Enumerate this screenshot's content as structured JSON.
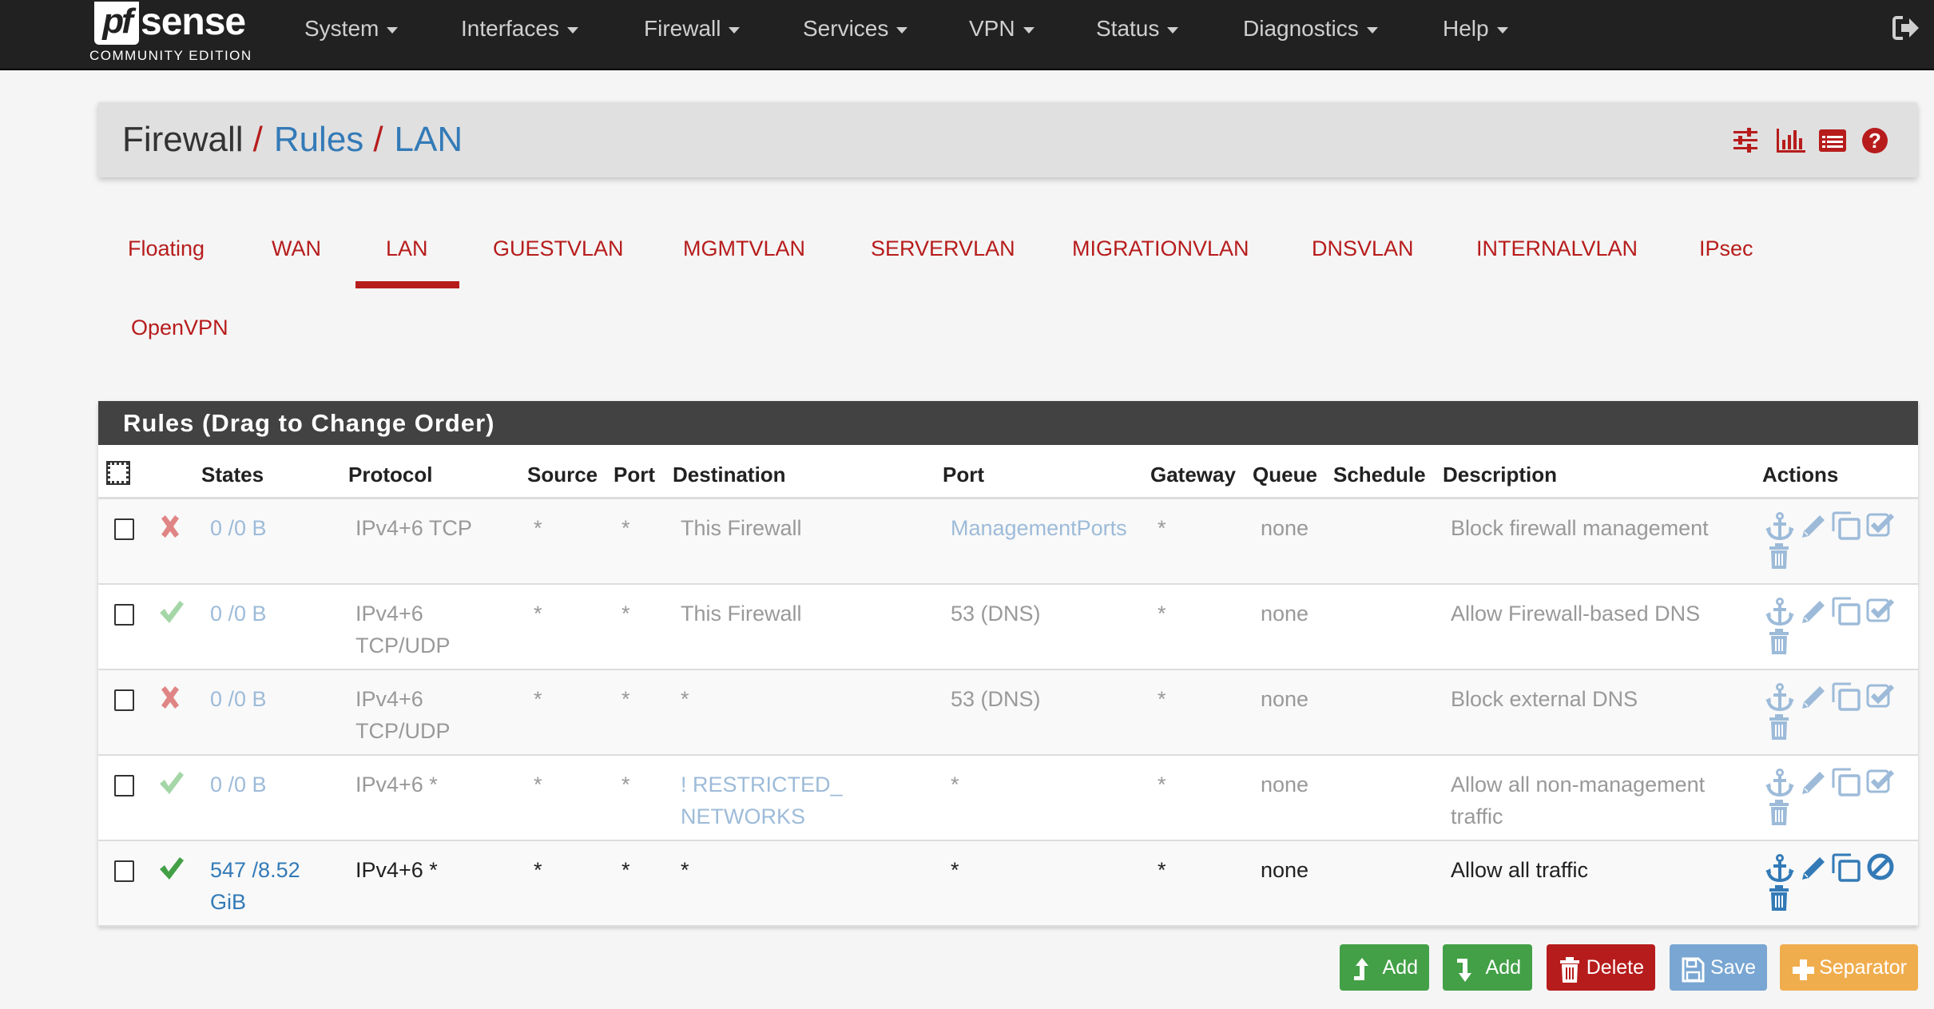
{
  "brand": {
    "logo_mark": "pf",
    "logo_word": "sense",
    "edition": "COMMUNITY EDITION"
  },
  "nav": {
    "items": [
      {
        "label": "System"
      },
      {
        "label": "Interfaces"
      },
      {
        "label": "Firewall"
      },
      {
        "label": "Services"
      },
      {
        "label": "VPN"
      },
      {
        "label": "Status"
      },
      {
        "label": "Diagnostics"
      },
      {
        "label": "Help"
      }
    ],
    "logout_icon": "sign-out-icon"
  },
  "breadcrumb": {
    "root": "Firewall",
    "separator": "/",
    "level1": "Rules",
    "level2": "LAN",
    "icons": [
      "sliders-icon",
      "bar-chart-icon",
      "list-table-icon",
      "help-circle-icon"
    ]
  },
  "tabs": {
    "items": [
      {
        "label": "Floating"
      },
      {
        "label": "WAN"
      },
      {
        "label": "LAN",
        "active": true
      },
      {
        "label": "GUESTVLAN"
      },
      {
        "label": "MGMTVLAN"
      },
      {
        "label": "SERVERVLAN"
      },
      {
        "label": "MIGRATIONVLAN"
      },
      {
        "label": "DNSVLAN"
      },
      {
        "label": "INTERNALVLAN"
      },
      {
        "label": "IPsec"
      },
      {
        "label": "OpenVPN"
      }
    ]
  },
  "rules": {
    "panel_title": "Rules (Drag to Change Order)",
    "columns": [
      "States",
      "Protocol",
      "Source",
      "Port",
      "Destination",
      "Port",
      "Gateway",
      "Queue",
      "Schedule",
      "Description",
      "Actions"
    ],
    "rows": [
      {
        "action": "block",
        "enabled": false,
        "states_line1": "0 /0 B",
        "states_line2": "",
        "protocol_line1": "IPv4+6 TCP",
        "protocol_line2": "",
        "source": "*",
        "source_port": "*",
        "destination_line1": "This Firewall",
        "destination_line2": "",
        "destination_is_alias": false,
        "dest_port": "ManagementPorts",
        "dest_port_is_alias": true,
        "gateway": "*",
        "queue": "none",
        "schedule": "",
        "description_line1": "Block firewall management",
        "description_line2": "",
        "toggle_icon": "check-square-icon"
      },
      {
        "action": "pass",
        "enabled": false,
        "states_line1": "0 /0 B",
        "states_line2": "",
        "protocol_line1": "IPv4+6",
        "protocol_line2": "TCP/UDP",
        "source": "*",
        "source_port": "*",
        "destination_line1": "This Firewall",
        "destination_line2": "",
        "destination_is_alias": false,
        "dest_port": "53 (DNS)",
        "dest_port_is_alias": false,
        "gateway": "*",
        "queue": "none",
        "schedule": "",
        "description_line1": "Allow Firewall-based DNS",
        "description_line2": "",
        "toggle_icon": "check-square-icon"
      },
      {
        "action": "block",
        "enabled": false,
        "states_line1": "0 /0 B",
        "states_line2": "",
        "protocol_line1": "IPv4+6",
        "protocol_line2": "TCP/UDP",
        "source": "*",
        "source_port": "*",
        "destination_line1": "*",
        "destination_line2": "",
        "destination_is_alias": false,
        "dest_port": "53 (DNS)",
        "dest_port_is_alias": false,
        "gateway": "*",
        "queue": "none",
        "schedule": "",
        "description_line1": "Block external DNS",
        "description_line2": "",
        "toggle_icon": "check-square-icon"
      },
      {
        "action": "pass",
        "enabled": false,
        "states_line1": "0 /0 B",
        "states_line2": "",
        "protocol_line1": "IPv4+6 *",
        "protocol_line2": "",
        "source": "*",
        "source_port": "*",
        "destination_line1": "! RESTRICTED_",
        "destination_line2": "NETWORKS",
        "destination_is_alias": true,
        "dest_port": "*",
        "dest_port_is_alias": false,
        "gateway": "*",
        "queue": "none",
        "schedule": "",
        "description_line1": "Allow all non-management",
        "description_line2": "traffic",
        "toggle_icon": "check-square-icon"
      },
      {
        "action": "pass",
        "enabled": true,
        "states_line1": "547 /8.52",
        "states_line2": "GiB",
        "protocol_line1": "IPv4+6 *",
        "protocol_line2": "",
        "source": "*",
        "source_port": "*",
        "destination_line1": "*",
        "destination_line2": "",
        "destination_is_alias": false,
        "dest_port": "*",
        "dest_port_is_alias": false,
        "gateway": "*",
        "queue": "none",
        "schedule": "",
        "description_line1": "Allow all traffic",
        "description_line2": "",
        "toggle_icon": "ban-icon"
      }
    ]
  },
  "buttons": {
    "add_top": "Add",
    "add_bottom": "Add",
    "delete": "Delete",
    "save": "Save",
    "separator": "Separator"
  },
  "colors": {
    "navbar": "#212121",
    "accent_red": "#b71c1c",
    "link_blue": "#337ab7",
    "muted_blue": "#9dbbd9",
    "pass_green": "#43a047",
    "pass_green_muted": "#a5d6a7",
    "block_red_muted": "#e08585",
    "btn_success": "#43a047",
    "btn_danger": "#b71c1c",
    "btn_save": "#79a6d2",
    "btn_warning": "#f0ad4e"
  }
}
